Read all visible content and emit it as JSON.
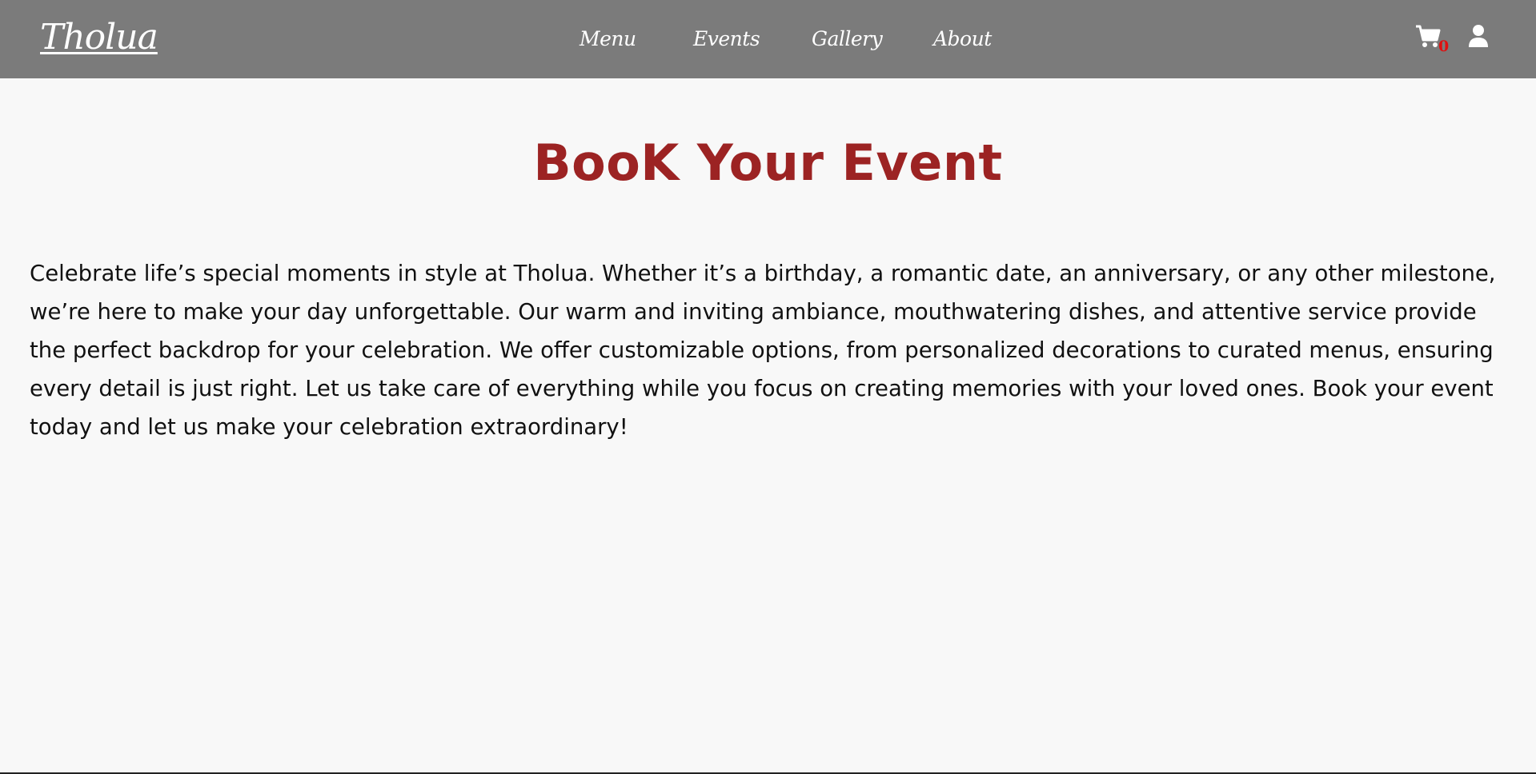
{
  "header": {
    "logo_text": "Tholua",
    "nav_items": [
      {
        "label": "Menu"
      },
      {
        "label": "Events"
      },
      {
        "label": "Gallery"
      },
      {
        "label": "About"
      }
    ],
    "cart": {
      "icon": "cart-icon",
      "count": "0"
    },
    "user": {
      "icon": "user-icon"
    }
  },
  "main": {
    "title": "BooK Your Event",
    "description": "Celebrate life’s special moments in style at Tholua. Whether it’s a birthday, a romantic date, an anniversary, or any other milestone, we’re here to make your day unforgettable. Our warm and inviting ambiance, mouthwatering dishes, and attentive service provide the perfect backdrop for your celebration. We offer customizable options, from personalized decorations to curated menus, ensuring every detail is just right. Let us take care of everything while you focus on creating memories with your loved ones. Book your event today and let us make your celebration extraordinary!"
  },
  "colors": {
    "header_bg": "#7b7b7b",
    "page_bg": "#f8f8f8",
    "title": "#9c2323",
    "cart_count": "#e01010"
  }
}
